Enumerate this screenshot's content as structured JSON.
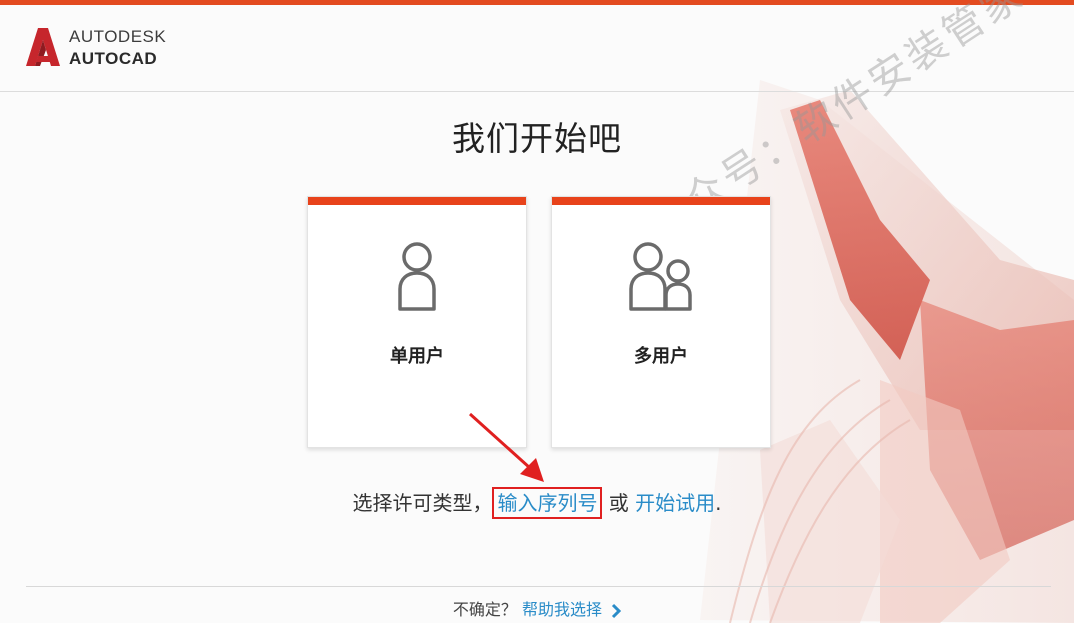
{
  "brand": {
    "line1": "AUTODESK",
    "line2": "AUTOCAD",
    "mark": "®"
  },
  "title": "我们开始吧",
  "cards": [
    {
      "label": "单用户",
      "icon": "single-user-icon"
    },
    {
      "label": "多用户",
      "icon": "multi-user-icon"
    }
  ],
  "license": {
    "prefix": "选择许可类型，",
    "serial_link": "输入序列号",
    "or": " 或 ",
    "trial_link": "开始试用",
    "suffix": "."
  },
  "footer": {
    "question": "不确定？",
    "help_link": "帮助我选择"
  },
  "watermark": "微信公众号：软件安装管家",
  "colors": {
    "accent": "#e8431b",
    "link": "#2a8cc8",
    "highlight_box": "#e02020"
  }
}
